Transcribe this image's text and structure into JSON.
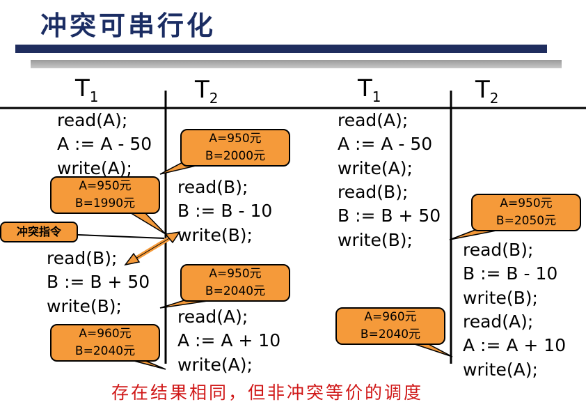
{
  "title": "冲突可串行化",
  "left": {
    "headers": {
      "t1": "T",
      "t1_sub": "1",
      "t2": "T",
      "t2_sub": "2"
    },
    "t1_ops_a": [
      "read(A);",
      "A := A - 50",
      "write(A);"
    ],
    "t2_ops_a": [
      "read(B);",
      "B := B - 10",
      "write(B);"
    ],
    "t1_ops_b": [
      "read(B);",
      "B := B + 50",
      "write(B);"
    ],
    "t2_ops_b": [
      "read(A);",
      "A := A + 10",
      "write(A);"
    ],
    "bubbles": [
      {
        "a": "A=950元",
        "b": "B=2000元"
      },
      {
        "a": "A=950元",
        "b": "B=1990元"
      },
      {
        "a": "A=950元",
        "b": "B=2040元"
      },
      {
        "a": "A=960元",
        "b": "B=2040元"
      }
    ],
    "conflict_label": "冲突指令"
  },
  "right": {
    "headers": {
      "t1": "T",
      "t1_sub": "1",
      "t2": "T",
      "t2_sub": "2"
    },
    "t1_ops": [
      "read(A);",
      "A := A - 50",
      "write(A);",
      "read(B);",
      "B := B + 50",
      "write(B);"
    ],
    "t2_ops": [
      "read(B);",
      "B := B - 10",
      "write(B);",
      "read(A);",
      "A := A + 10",
      "write(A);"
    ],
    "bubbles": [
      {
        "a": "A=950元",
        "b": "B=2050元"
      },
      {
        "a": "A=960元",
        "b": "B=2040元"
      }
    ]
  },
  "footer_note": "存在结果相同，但非冲突等价的调度"
}
